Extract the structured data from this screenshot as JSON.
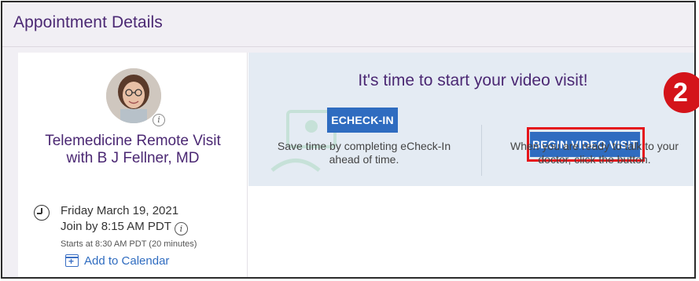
{
  "header": {
    "title": "Appointment Details"
  },
  "appointment": {
    "title": "Telemedicine Remote Visit with B J Fellner, MD",
    "date": "Friday March 19, 2021",
    "join_by": "Join by 8:15 AM PDT",
    "starts": "Starts at 8:30 AM PDT (20 minutes)",
    "add_to_calendar": "Add to Calendar"
  },
  "banner": {
    "title": "It's time to start your video visit!",
    "echeck_button": "ECHECK-IN",
    "echeck_desc": "Save time by completing eCheck-In ahead of time.",
    "video_button": "BEGIN VIDEO VISIT",
    "video_desc": "When you are ready to talk to your doctor, click the button."
  },
  "step_badge": "2",
  "colors": {
    "brand_purple": "#4b2873",
    "button_blue": "#2f6cc0",
    "highlight_red": "#e5141a",
    "banner_bg": "#e4ebf3"
  },
  "icons": {
    "clock": "clock-icon",
    "calendar": "calendar-add-icon",
    "info": "info-icon"
  }
}
